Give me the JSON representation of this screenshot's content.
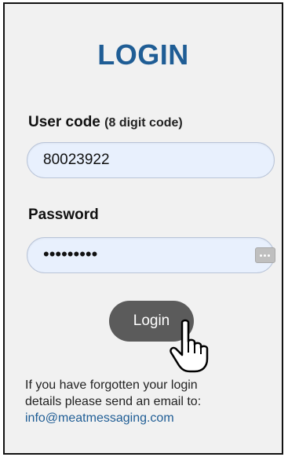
{
  "login": {
    "title": "LOGIN",
    "user_code": {
      "label": "User code",
      "hint": "(8 digit code)",
      "value": "80023922"
    },
    "password": {
      "label": "Password",
      "value": "•••••••••"
    },
    "button_label": "Login",
    "help": {
      "line1": "If you have forgotten your login",
      "line2": "details please send an email to:",
      "email": "info@meatmessaging.com"
    }
  },
  "icons": {
    "password_key": "password-manager-key-icon",
    "cursor": "hand-pointer-cursor-icon"
  },
  "colors": {
    "title": "#1f5d95",
    "panel_bg": "#f1f1f1",
    "field_bg": "#e8f0fd",
    "button_bg": "#5b5b5b",
    "link": "#1f5d95"
  }
}
